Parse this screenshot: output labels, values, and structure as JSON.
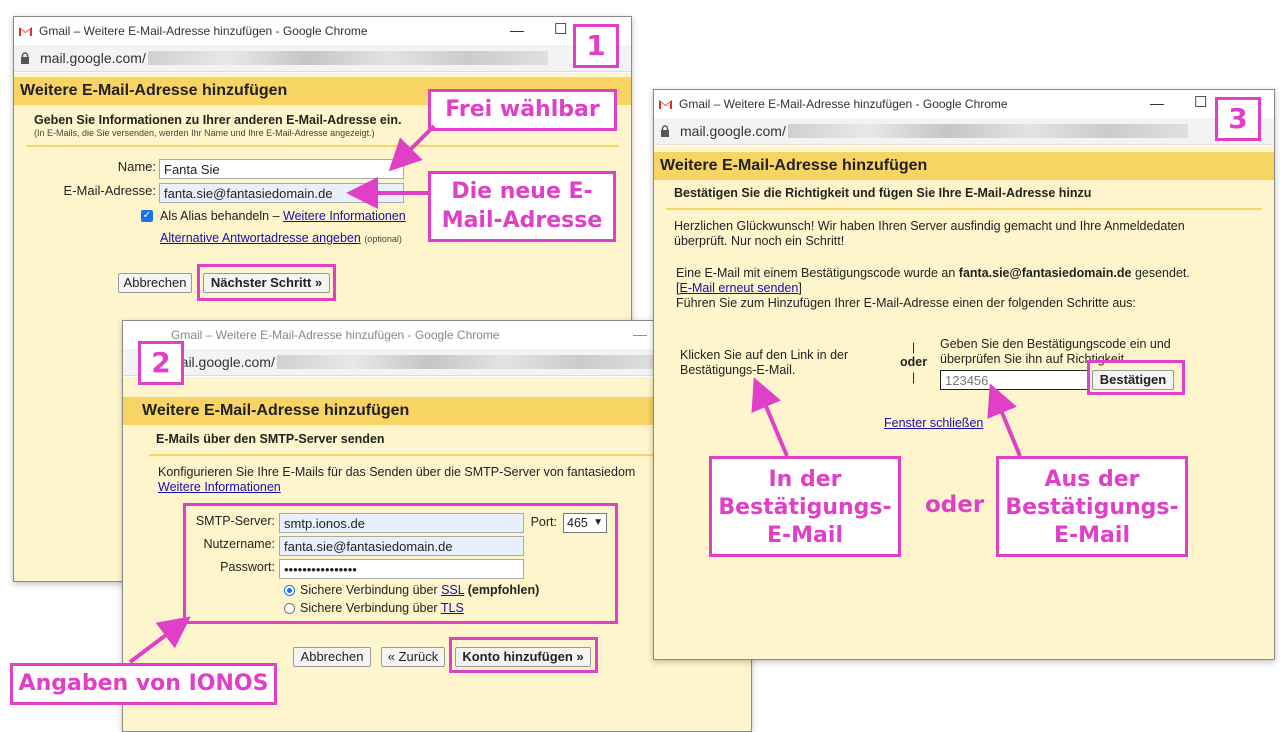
{
  "colors": {
    "accent": "#e040c8",
    "header_bg": "#f7d463",
    "content_bg": "#fff5cc",
    "link": "#1a0dab"
  },
  "window1": {
    "title": "Gmail – Weitere E-Mail-Adresse hinzufügen - Google Chrome",
    "url": "mail.google.com/",
    "step": "1",
    "header": "Weitere E-Mail-Adresse hinzufügen",
    "subtitle": "Geben Sie Informationen zu Ihrer anderen E-Mail-Adresse ein.",
    "note": "(In E-Mails, die Sie versenden, werden Ihr Name und Ihre E-Mail-Adresse angezeigt.)",
    "name_label": "Name:",
    "name_value": "Fanta Sie",
    "email_label": "E-Mail-Adresse:",
    "email_value": "fanta.sie@fantasiedomain.de",
    "alias_label": "Als Alias behandeln –",
    "alias_link": "Weitere Informationen",
    "alt_reply_link": "Alternative Antwortadresse angeben",
    "optional": "(optional)",
    "cancel": "Abbrechen",
    "next": "Nächster Schritt »"
  },
  "window2": {
    "title": "Gmail – Weitere E-Mail-Adresse hinzufügen - Google Chrome",
    "url": "mail.google.com/",
    "step": "2",
    "header": "Weitere E-Mail-Adresse hinzufügen",
    "subtitle": "E-Mails über den SMTP-Server senden",
    "intro": "Konfigurieren Sie Ihre E-Mails für das Senden über die SMTP-Server von fantasiedom",
    "more_link": "Weitere Informationen",
    "smtp_label": "SMTP-Server:",
    "smtp_value": "smtp.ionos.de",
    "port_label": "Port:",
    "port_value": "465",
    "user_label": "Nutzername:",
    "user_value": "fanta.sie@fantasiedomain.de",
    "pass_label": "Passwort:",
    "pass_value": "••••••••••••••••",
    "ssl_prefix": "Sichere Verbindung über",
    "ssl_link": "SSL",
    "ssl_suffix": "(empfohlen)",
    "tls_prefix": "Sichere Verbindung über",
    "tls_link": "TLS",
    "cancel": "Abbrechen",
    "back": "« Zurück",
    "add": "Konto hinzufügen »"
  },
  "window3": {
    "title": "Gmail – Weitere E-Mail-Adresse hinzufügen - Google Chrome",
    "url": "mail.google.com/",
    "step": "3",
    "header": "Weitere E-Mail-Adresse hinzufügen",
    "subtitle": "Bestätigen Sie die Richtigkeit und fügen Sie Ihre E-Mail-Adresse hinzu",
    "congrats1": "Herzlichen Glückwunsch! Wir haben Ihren Server ausfindig gemacht und Ihre Anmeldedaten",
    "congrats2": "überprüft. Nur noch ein Schritt!",
    "sent_prefix": "Eine E-Mail mit einem Bestätigungscode wurde an",
    "sent_email": "fanta.sie@fantasiedomain.de",
    "sent_suffix": "gesendet.",
    "resend": "E-Mail erneut senden",
    "instruction": "Führen Sie zum Hinzufügen Ihrer E-Mail-Adresse einen der folgenden Schritte aus:",
    "left_option1": "Klicken Sie auf den Link in der",
    "left_option2": "Bestätigungs-E-Mail.",
    "or": "oder",
    "right_option1": "Geben Sie den Bestätigungscode ein und",
    "right_option2": "überprüfen Sie ihn auf Richtigkeit",
    "code_placeholder": "123456",
    "confirm": "Bestätigen",
    "close": "Fenster schließen"
  },
  "callouts": {
    "frei": "Frei wählbar",
    "neue": "Die neue E-Mail-Adresse",
    "ionos": "Angaben von IONOS",
    "in_mail": "In der Bestätigungs-E-Mail",
    "oder": "oder",
    "aus_mail": "Aus der Bestätigungs-E-Mail"
  }
}
